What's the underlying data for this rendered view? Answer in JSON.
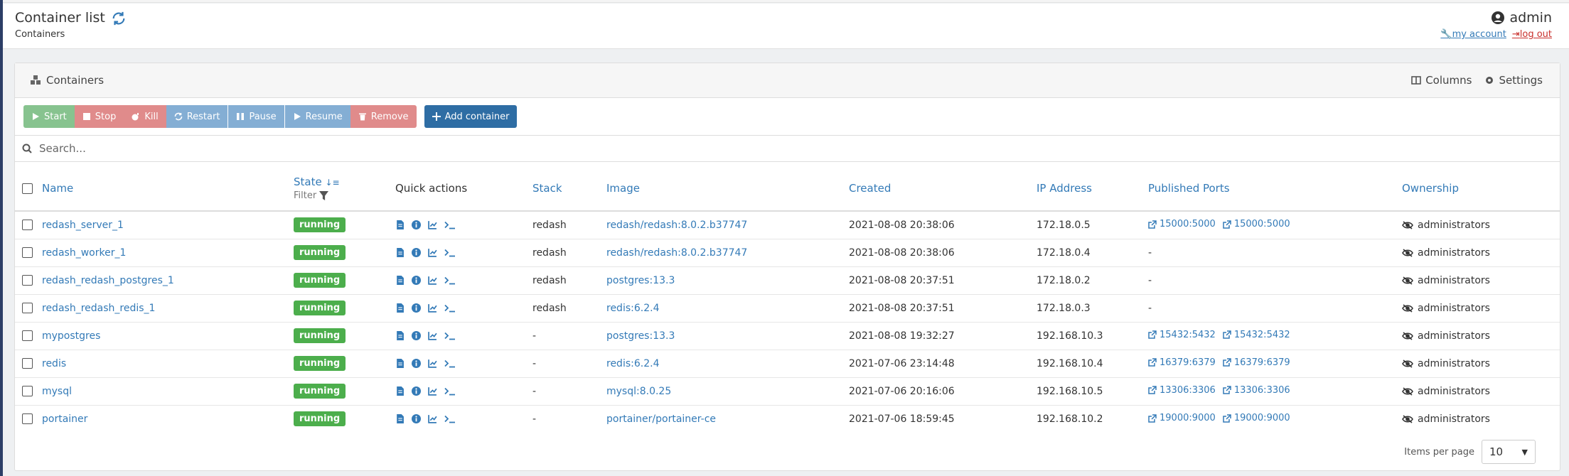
{
  "header": {
    "title": "Container list",
    "subtitle": "Containers",
    "user": "admin",
    "my_account": "my account",
    "log_out": "log out"
  },
  "panel": {
    "title": "Containers",
    "columns_label": "Columns",
    "settings_label": "Settings"
  },
  "toolbar": {
    "start": "Start",
    "stop": "Stop",
    "kill": "Kill",
    "restart": "Restart",
    "pause": "Pause",
    "resume": "Resume",
    "remove": "Remove",
    "add": "Add container"
  },
  "search": {
    "placeholder": "Search..."
  },
  "table": {
    "headers": {
      "name": "Name",
      "state": "State",
      "state_filter": "Filter",
      "quick_actions": "Quick actions",
      "stack": "Stack",
      "image": "Image",
      "created": "Created",
      "ip": "IP Address",
      "ports": "Published Ports",
      "ownership": "Ownership"
    },
    "rows": [
      {
        "name": "redash_server_1",
        "state": "running",
        "stack": "redash",
        "image": "redash/redash:8.0.2.b37747",
        "created": "2021-08-08 20:38:06",
        "ip": "172.18.0.5",
        "ports": [
          "15000:5000",
          "15000:5000"
        ],
        "ownership": "administrators"
      },
      {
        "name": "redash_worker_1",
        "state": "running",
        "stack": "redash",
        "image": "redash/redash:8.0.2.b37747",
        "created": "2021-08-08 20:38:06",
        "ip": "172.18.0.4",
        "ports": [],
        "ports_text": "-",
        "ownership": "administrators"
      },
      {
        "name": "redash_redash_postgres_1",
        "state": "running",
        "stack": "redash",
        "image": "postgres:13.3",
        "created": "2021-08-08 20:37:51",
        "ip": "172.18.0.2",
        "ports": [],
        "ports_text": "-",
        "ownership": "administrators"
      },
      {
        "name": "redash_redash_redis_1",
        "state": "running",
        "stack": "redash",
        "image": "redis:6.2.4",
        "created": "2021-08-08 20:37:51",
        "ip": "172.18.0.3",
        "ports": [],
        "ports_text": "-",
        "ownership": "administrators"
      },
      {
        "name": "mypostgres",
        "state": "running",
        "stack": "-",
        "image": "postgres:13.3",
        "created": "2021-08-08 19:32:27",
        "ip": "192.168.10.3",
        "ports": [
          "15432:5432",
          "15432:5432"
        ],
        "ownership": "administrators"
      },
      {
        "name": "redis",
        "state": "running",
        "stack": "-",
        "image": "redis:6.2.4",
        "created": "2021-07-06 23:14:48",
        "ip": "192.168.10.4",
        "ports": [
          "16379:6379",
          "16379:6379"
        ],
        "ownership": "administrators"
      },
      {
        "name": "mysql",
        "state": "running",
        "stack": "-",
        "image": "mysql:8.0.25",
        "created": "2021-07-06 20:16:06",
        "ip": "192.168.10.5",
        "ports": [
          "13306:3306",
          "13306:3306"
        ],
        "ownership": "administrators"
      },
      {
        "name": "portainer",
        "state": "running",
        "stack": "-",
        "image": "portainer/portainer-ce",
        "created": "2021-07-06 18:59:45",
        "ip": "192.168.10.2",
        "ports": [
          "19000:9000",
          "19000:9000"
        ],
        "ownership": "administrators"
      }
    ]
  },
  "footer": {
    "items_per_page_label": "Items per page",
    "items_per_page": "10"
  },
  "colors": {
    "accent": "#337ab7",
    "running": "#4cae4c",
    "primary_button": "#2e6da4"
  },
  "icons": {
    "quick_actions": [
      "logs-icon",
      "inspect-icon",
      "stats-icon",
      "console-icon"
    ],
    "port": "external-link-icon",
    "ownership": "eye-slash-icon"
  }
}
